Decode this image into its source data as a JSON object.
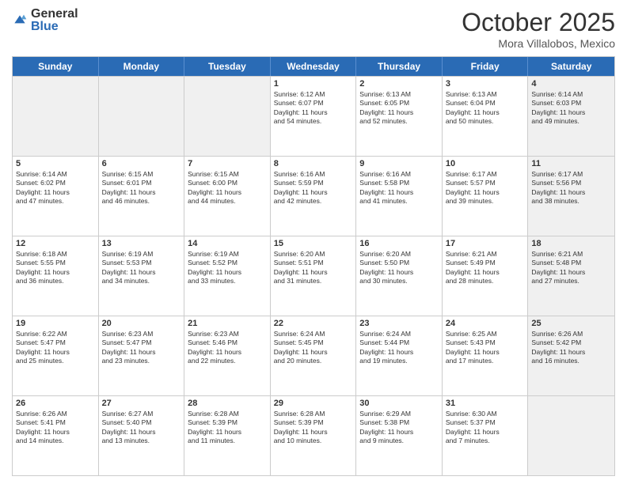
{
  "header": {
    "logo_general": "General",
    "logo_blue": "Blue",
    "month": "October 2025",
    "location": "Mora Villalobos, Mexico"
  },
  "days_of_week": [
    "Sunday",
    "Monday",
    "Tuesday",
    "Wednesday",
    "Thursday",
    "Friday",
    "Saturday"
  ],
  "weeks": [
    [
      {
        "day": "",
        "info": "",
        "shaded": true
      },
      {
        "day": "",
        "info": "",
        "shaded": true
      },
      {
        "day": "",
        "info": "",
        "shaded": true
      },
      {
        "day": "1",
        "info": "Sunrise: 6:12 AM\nSunset: 6:07 PM\nDaylight: 11 hours\nand 54 minutes.",
        "shaded": false
      },
      {
        "day": "2",
        "info": "Sunrise: 6:13 AM\nSunset: 6:05 PM\nDaylight: 11 hours\nand 52 minutes.",
        "shaded": false
      },
      {
        "day": "3",
        "info": "Sunrise: 6:13 AM\nSunset: 6:04 PM\nDaylight: 11 hours\nand 50 minutes.",
        "shaded": false
      },
      {
        "day": "4",
        "info": "Sunrise: 6:14 AM\nSunset: 6:03 PM\nDaylight: 11 hours\nand 49 minutes.",
        "shaded": true
      }
    ],
    [
      {
        "day": "5",
        "info": "Sunrise: 6:14 AM\nSunset: 6:02 PM\nDaylight: 11 hours\nand 47 minutes.",
        "shaded": false
      },
      {
        "day": "6",
        "info": "Sunrise: 6:15 AM\nSunset: 6:01 PM\nDaylight: 11 hours\nand 46 minutes.",
        "shaded": false
      },
      {
        "day": "7",
        "info": "Sunrise: 6:15 AM\nSunset: 6:00 PM\nDaylight: 11 hours\nand 44 minutes.",
        "shaded": false
      },
      {
        "day": "8",
        "info": "Sunrise: 6:16 AM\nSunset: 5:59 PM\nDaylight: 11 hours\nand 42 minutes.",
        "shaded": false
      },
      {
        "day": "9",
        "info": "Sunrise: 6:16 AM\nSunset: 5:58 PM\nDaylight: 11 hours\nand 41 minutes.",
        "shaded": false
      },
      {
        "day": "10",
        "info": "Sunrise: 6:17 AM\nSunset: 5:57 PM\nDaylight: 11 hours\nand 39 minutes.",
        "shaded": false
      },
      {
        "day": "11",
        "info": "Sunrise: 6:17 AM\nSunset: 5:56 PM\nDaylight: 11 hours\nand 38 minutes.",
        "shaded": true
      }
    ],
    [
      {
        "day": "12",
        "info": "Sunrise: 6:18 AM\nSunset: 5:55 PM\nDaylight: 11 hours\nand 36 minutes.",
        "shaded": false
      },
      {
        "day": "13",
        "info": "Sunrise: 6:19 AM\nSunset: 5:53 PM\nDaylight: 11 hours\nand 34 minutes.",
        "shaded": false
      },
      {
        "day": "14",
        "info": "Sunrise: 6:19 AM\nSunset: 5:52 PM\nDaylight: 11 hours\nand 33 minutes.",
        "shaded": false
      },
      {
        "day": "15",
        "info": "Sunrise: 6:20 AM\nSunset: 5:51 PM\nDaylight: 11 hours\nand 31 minutes.",
        "shaded": false
      },
      {
        "day": "16",
        "info": "Sunrise: 6:20 AM\nSunset: 5:50 PM\nDaylight: 11 hours\nand 30 minutes.",
        "shaded": false
      },
      {
        "day": "17",
        "info": "Sunrise: 6:21 AM\nSunset: 5:49 PM\nDaylight: 11 hours\nand 28 minutes.",
        "shaded": false
      },
      {
        "day": "18",
        "info": "Sunrise: 6:21 AM\nSunset: 5:48 PM\nDaylight: 11 hours\nand 27 minutes.",
        "shaded": true
      }
    ],
    [
      {
        "day": "19",
        "info": "Sunrise: 6:22 AM\nSunset: 5:47 PM\nDaylight: 11 hours\nand 25 minutes.",
        "shaded": false
      },
      {
        "day": "20",
        "info": "Sunrise: 6:23 AM\nSunset: 5:47 PM\nDaylight: 11 hours\nand 23 minutes.",
        "shaded": false
      },
      {
        "day": "21",
        "info": "Sunrise: 6:23 AM\nSunset: 5:46 PM\nDaylight: 11 hours\nand 22 minutes.",
        "shaded": false
      },
      {
        "day": "22",
        "info": "Sunrise: 6:24 AM\nSunset: 5:45 PM\nDaylight: 11 hours\nand 20 minutes.",
        "shaded": false
      },
      {
        "day": "23",
        "info": "Sunrise: 6:24 AM\nSunset: 5:44 PM\nDaylight: 11 hours\nand 19 minutes.",
        "shaded": false
      },
      {
        "day": "24",
        "info": "Sunrise: 6:25 AM\nSunset: 5:43 PM\nDaylight: 11 hours\nand 17 minutes.",
        "shaded": false
      },
      {
        "day": "25",
        "info": "Sunrise: 6:26 AM\nSunset: 5:42 PM\nDaylight: 11 hours\nand 16 minutes.",
        "shaded": true
      }
    ],
    [
      {
        "day": "26",
        "info": "Sunrise: 6:26 AM\nSunset: 5:41 PM\nDaylight: 11 hours\nand 14 minutes.",
        "shaded": false
      },
      {
        "day": "27",
        "info": "Sunrise: 6:27 AM\nSunset: 5:40 PM\nDaylight: 11 hours\nand 13 minutes.",
        "shaded": false
      },
      {
        "day": "28",
        "info": "Sunrise: 6:28 AM\nSunset: 5:39 PM\nDaylight: 11 hours\nand 11 minutes.",
        "shaded": false
      },
      {
        "day": "29",
        "info": "Sunrise: 6:28 AM\nSunset: 5:39 PM\nDaylight: 11 hours\nand 10 minutes.",
        "shaded": false
      },
      {
        "day": "30",
        "info": "Sunrise: 6:29 AM\nSunset: 5:38 PM\nDaylight: 11 hours\nand 9 minutes.",
        "shaded": false
      },
      {
        "day": "31",
        "info": "Sunrise: 6:30 AM\nSunset: 5:37 PM\nDaylight: 11 hours\nand 7 minutes.",
        "shaded": false
      },
      {
        "day": "",
        "info": "",
        "shaded": true
      }
    ]
  ]
}
